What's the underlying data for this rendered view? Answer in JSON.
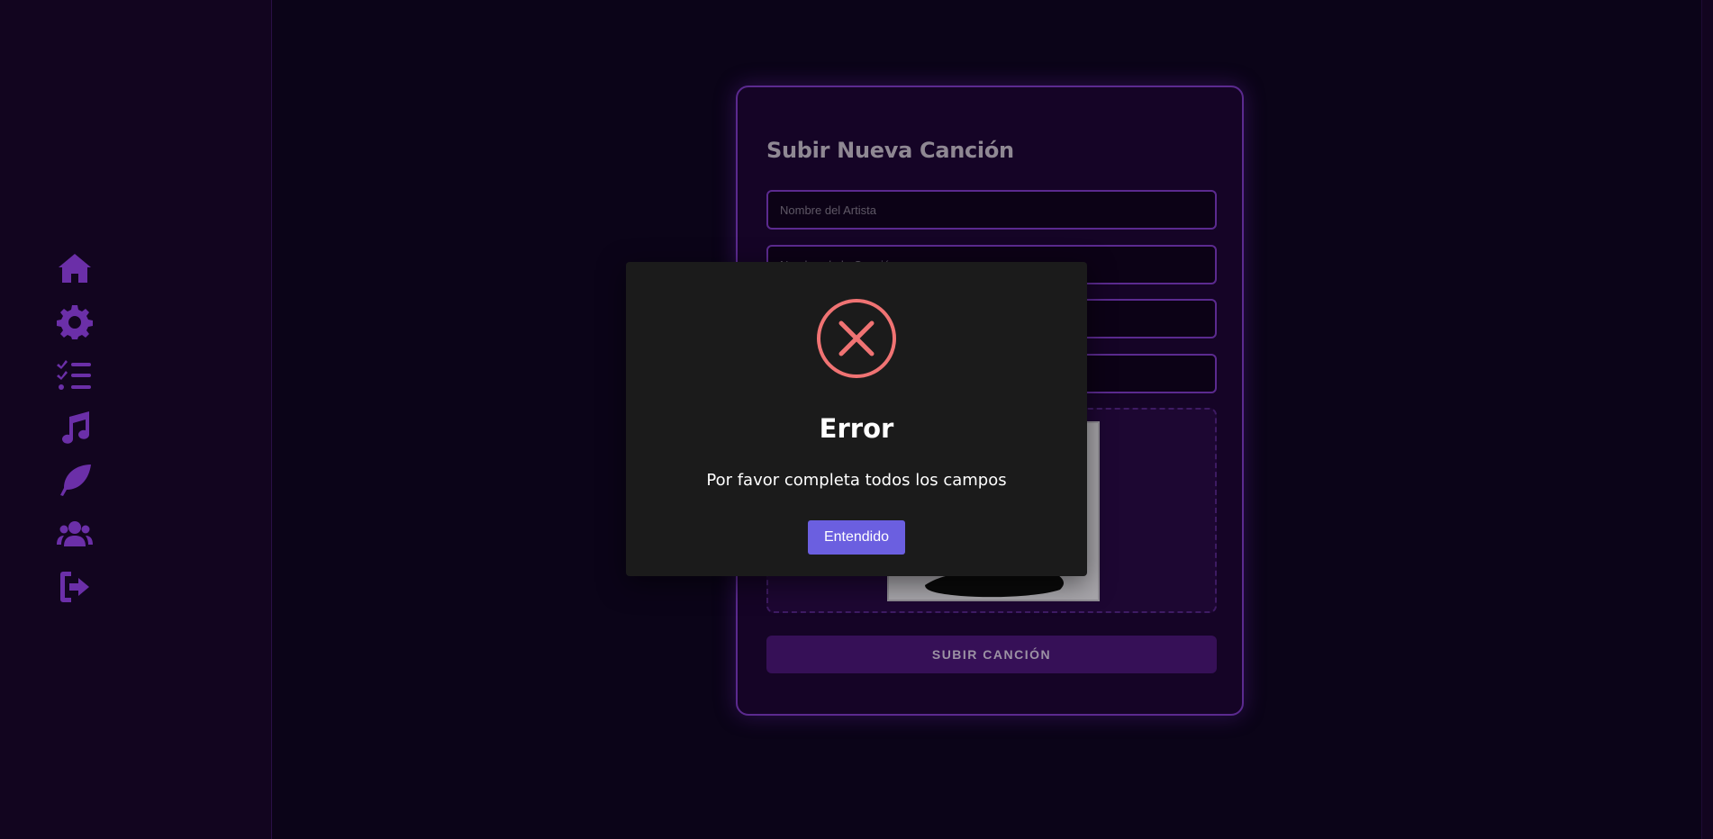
{
  "sidebar": {
    "items": [
      {
        "icon": "home-icon"
      },
      {
        "icon": "gear-icon"
      },
      {
        "icon": "task-list-icon"
      },
      {
        "icon": "music-icon"
      },
      {
        "icon": "feather-icon"
      },
      {
        "icon": "users-icon"
      },
      {
        "icon": "logout-icon"
      }
    ],
    "icon_color": "#6b2fa8"
  },
  "form": {
    "title": "Subir Nueva Canción",
    "fields": [
      {
        "name": "artist",
        "placeholder": "Nombre del Artista",
        "value": ""
      },
      {
        "name": "song",
        "placeholder": "Nombre de la Canción",
        "value": ""
      },
      {
        "name": "field-3",
        "placeholder": "",
        "value": ""
      },
      {
        "name": "field-4",
        "placeholder": "",
        "value": ""
      }
    ],
    "submit_label": "SUBIR CANCIÓN",
    "accent": "#5b2a8f"
  },
  "modal": {
    "icon": "error-x-icon",
    "icon_color": "#f07373",
    "title": "Error",
    "message": "Por favor completa todos los campos",
    "confirm_label": "Entendido",
    "confirm_color": "#6b5fe0"
  }
}
